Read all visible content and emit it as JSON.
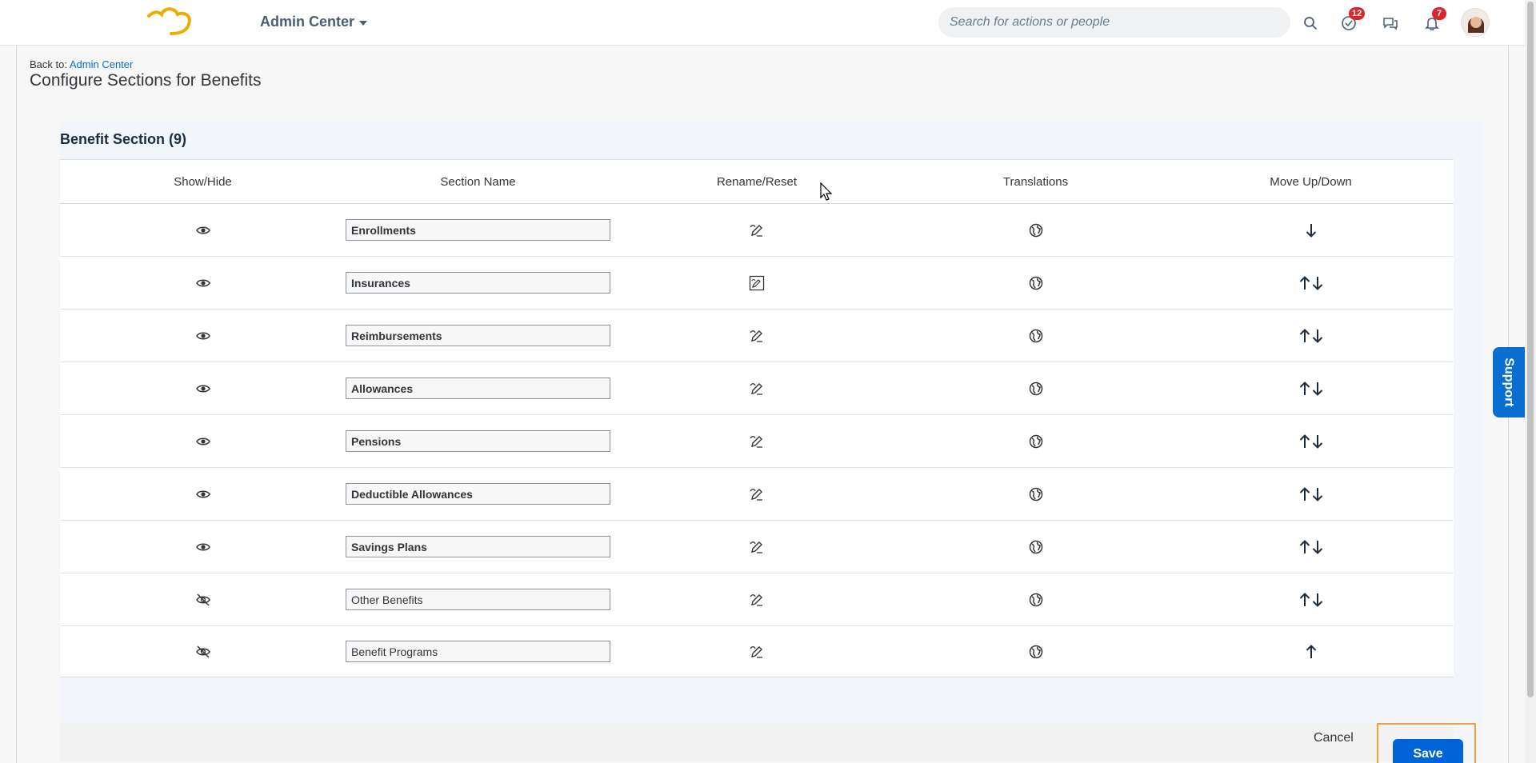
{
  "header": {
    "app_title": "Admin Center",
    "search_placeholder": "Search for actions or people",
    "tasks_badge": "12",
    "notifications_badge": "7"
  },
  "breadcrumb": {
    "prefix": "Back to:",
    "link": "Admin Center"
  },
  "page_title": "Configure Sections for Benefits",
  "section": {
    "title": "Benefit Section (9)",
    "columns": [
      "Show/Hide",
      "Section Name",
      "Rename/Reset",
      "Translations",
      "Move Up/Down"
    ],
    "rows": [
      {
        "name": "Enrollments",
        "visible": true,
        "move": "down"
      },
      {
        "name": "Insurances",
        "visible": true,
        "move": "both",
        "reset_icon": true
      },
      {
        "name": "Reimbursements",
        "visible": true,
        "move": "both"
      },
      {
        "name": "Allowances",
        "visible": true,
        "move": "both"
      },
      {
        "name": "Pensions",
        "visible": true,
        "move": "both"
      },
      {
        "name": "Deductible Allowances",
        "visible": true,
        "move": "both"
      },
      {
        "name": "Savings Plans",
        "visible": true,
        "move": "both"
      },
      {
        "name": "Other Benefits",
        "visible": false,
        "move": "both"
      },
      {
        "name": "Benefit Programs",
        "visible": false,
        "move": "up"
      }
    ]
  },
  "footer": {
    "cancel_label": "Cancel",
    "save_label": "Save"
  },
  "support_label": "Support",
  "colors": {
    "accent": "#0064d9",
    "highlight": "#e9a23b",
    "logo": "#f0ab00"
  }
}
